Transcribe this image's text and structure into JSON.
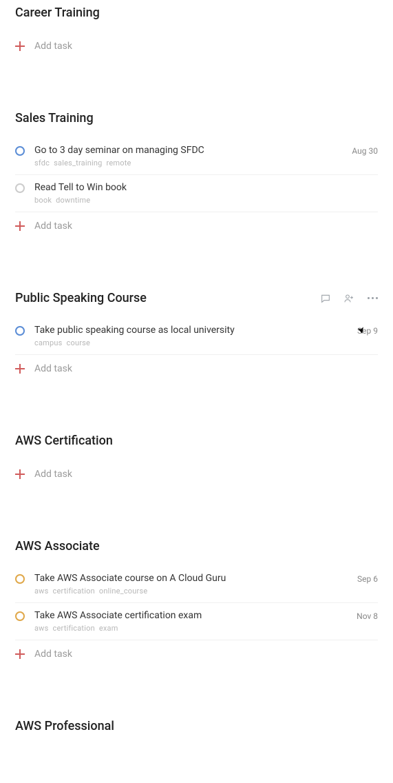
{
  "add_task_label": "Add task",
  "sections": [
    {
      "title": "Career Training",
      "tasks": []
    },
    {
      "title": "Sales Training",
      "tasks": [
        {
          "title": "Go to 3 day seminar on managing SFDC",
          "tags": [
            "sfdc",
            "sales_training",
            "remote"
          ],
          "date": "Aug 30",
          "ring": "blue"
        },
        {
          "title": "Read Tell to Win book",
          "tags": [
            "book",
            "downtime"
          ],
          "date": "",
          "ring": "gray"
        }
      ]
    },
    {
      "title": "Public Speaking Course",
      "hover": true,
      "tasks": [
        {
          "title": "Take public speaking course as local university",
          "tags": [
            "campus",
            "course"
          ],
          "date": "Sep 9",
          "ring": "blue"
        }
      ]
    },
    {
      "title": "AWS Certification",
      "tasks": []
    },
    {
      "title": "AWS Associate",
      "tasks": [
        {
          "title": "Take AWS Associate course on A Cloud Guru",
          "tags": [
            "aws",
            "certification",
            "online_course"
          ],
          "date": "Sep 6",
          "ring": "orange"
        },
        {
          "title": "Take AWS Associate certification exam",
          "tags": [
            "aws",
            "certification",
            "exam"
          ],
          "date": "Nov 8",
          "ring": "orange"
        }
      ]
    },
    {
      "title": "AWS Professional",
      "tasks": [],
      "hide_add": true
    }
  ]
}
